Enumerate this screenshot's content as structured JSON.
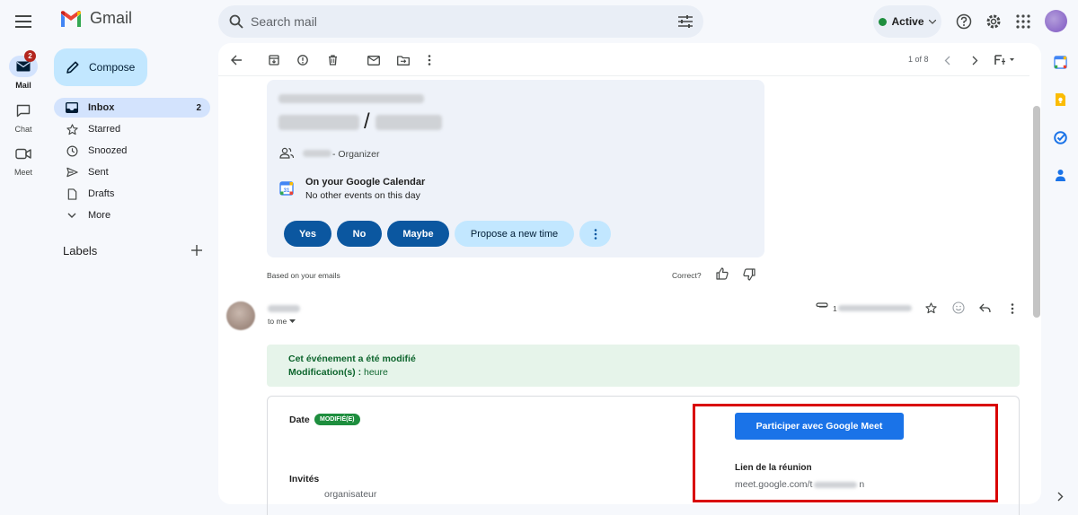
{
  "app": {
    "name": "Gmail"
  },
  "search": {
    "placeholder": "Search mail"
  },
  "status": {
    "label": "Active"
  },
  "rail": [
    {
      "label": "Mail",
      "badge": "2"
    },
    {
      "label": "Chat"
    },
    {
      "label": "Meet"
    }
  ],
  "nav": {
    "compose": "Compose",
    "items": [
      {
        "label": "Inbox",
        "count": "2"
      },
      {
        "label": "Starred"
      },
      {
        "label": "Snoozed"
      },
      {
        "label": "Sent"
      },
      {
        "label": "Drafts"
      },
      {
        "label": "More"
      }
    ],
    "labels_heading": "Labels"
  },
  "toolbar": {
    "pager": "1 of 8"
  },
  "invite": {
    "separator": "/",
    "organizer": "- Organizer",
    "calendar_title": "On your Google Calendar",
    "calendar_sub": "No other events on this day",
    "buttons": {
      "yes": "Yes",
      "no": "No",
      "maybe": "Maybe",
      "propose": "Propose a new time"
    },
    "based_on": "Based on your emails",
    "correct": "Correct?"
  },
  "message": {
    "to": "to me",
    "attachment_prefix": "1",
    "banner_title": "Cet événement a été modifié",
    "banner_mod_label": "Modification(s) :",
    "banner_mod_value": "heure",
    "date_label": "Date",
    "date_badge": "MODIFIÉ(E)",
    "guests_label": "Invités",
    "guest_role": "organisateur",
    "meet_button": "Participer avec Google Meet",
    "meeting_link_label": "Lien de la réunion",
    "meeting_link_prefix": "meet.google.com/t",
    "meeting_link_suffix": "n"
  },
  "colors": {
    "accent": "#0b57a0",
    "meet_button": "#1a73e8",
    "highlight_box": "#d90000",
    "modified_badge": "#1e8e3e"
  }
}
